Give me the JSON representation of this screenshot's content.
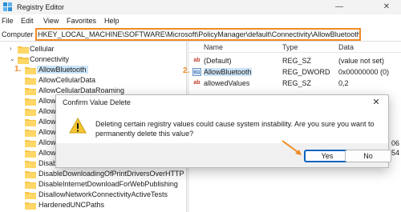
{
  "window": {
    "title": "Registry Editor",
    "minimize": "—",
    "close": "✕"
  },
  "menu": [
    "File",
    "Edit",
    "View",
    "Favorites",
    "Help"
  ],
  "address": {
    "label": "Computer",
    "path": "HKEY_LOCAL_MACHINE\\SOFTWARE\\Microsoft\\PolicyManager\\default\\Connectivity\\AllowBluetooth"
  },
  "tree": {
    "items": [
      {
        "label": "Cellular",
        "chevron": "›"
      },
      {
        "label": "Connectivity",
        "chevron": "⌄"
      },
      {
        "label": "AllowBluetooth",
        "selected": true
      },
      {
        "label": "AllowCellularData"
      },
      {
        "label": "AllowCellularDataRoaming"
      },
      {
        "label": "AllowC"
      },
      {
        "label": "AllowC"
      },
      {
        "label": "AllowP"
      },
      {
        "label": "AllowU"
      },
      {
        "label": "AllowV"
      },
      {
        "label": "AllowV"
      },
      {
        "label": "DisablePr"
      },
      {
        "label": "DisableDownloadingOfPrintDriversOverHTTP"
      },
      {
        "label": "DisableInternetDownloadForWebPublishing"
      },
      {
        "label": "DisallowNetworkConnectivityActiveTests"
      },
      {
        "label": "HardenedUNCPaths"
      }
    ]
  },
  "annotations": {
    "step1": "1.",
    "step2": "2."
  },
  "values": {
    "headers": {
      "name": "Name",
      "type": "Type",
      "data": "Data"
    },
    "rows": [
      {
        "icon": "ab",
        "name": "(Default)",
        "type": "REG_SZ",
        "data": "(value not set)"
      },
      {
        "icon": "011",
        "name": "AllowBluetooth",
        "type": "REG_DWORD",
        "data": "0x00000000 (0)"
      },
      {
        "icon": "ab",
        "name": "allowedValues",
        "type": "REG_SZ",
        "data": "0,2"
      }
    ],
    "clipped": [
      "06",
      "54"
    ]
  },
  "dialog": {
    "title": "Confirm Value Delete",
    "message": "Deleting certain registry values could cause system instability. Are you sure you want to permanently delete this value?",
    "yes": "Yes",
    "no": "No",
    "close": "✕"
  },
  "colors": {
    "accent_orange": "#f08a24",
    "selection": "#cce4f7",
    "primary_button": "#0a64c2",
    "folder": "#f5c44b"
  }
}
